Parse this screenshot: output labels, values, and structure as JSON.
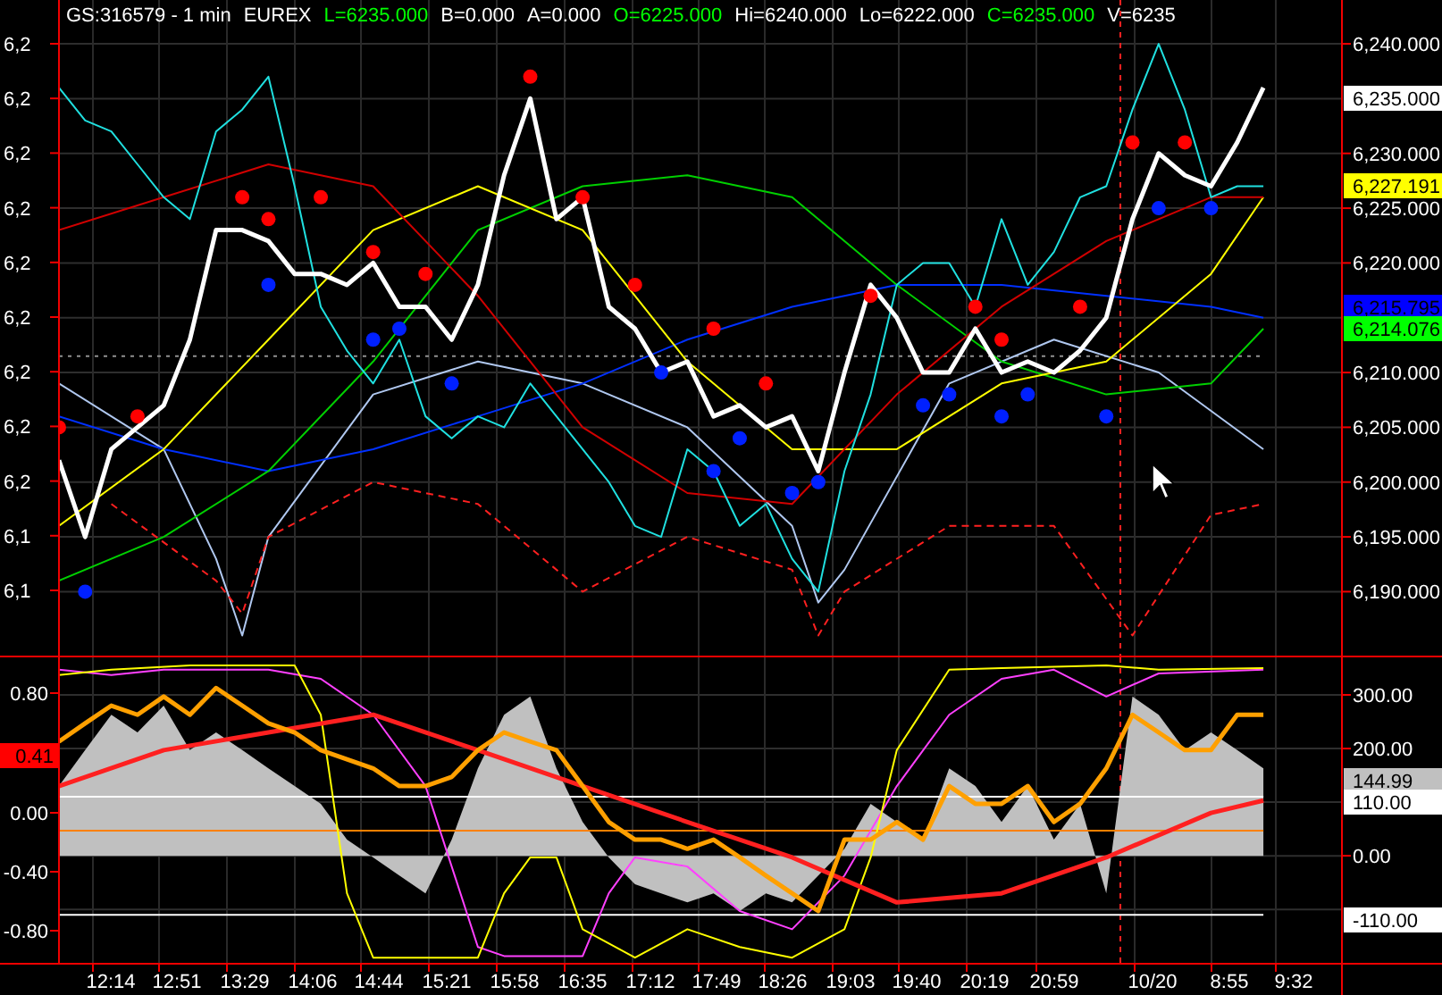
{
  "header": [
    {
      "text": "GS:316579 - 1 min",
      "color": "#ffffff"
    },
    {
      "text": "EUREX",
      "color": "#ffffff"
    },
    {
      "text": "L=6235.000",
      "color": "#00ff00"
    },
    {
      "text": "B=0.000",
      "color": "#ffffff"
    },
    {
      "text": "A=0.000",
      "color": "#ffffff"
    },
    {
      "text": "O=6225.000",
      "color": "#00ff00"
    },
    {
      "text": "Hi=6240.000",
      "color": "#ffffff"
    },
    {
      "text": "Lo=6222.000",
      "color": "#ffffff"
    },
    {
      "text": "C=6235.000",
      "color": "#00ff00"
    },
    {
      "text": "V=6235",
      "color": "#ffffff"
    }
  ],
  "price_panel": {
    "left_ticks": [
      "6,2",
      "6,2",
      "6,2",
      "6,2",
      "6,2",
      "6,2",
      "6,2",
      "6,2",
      "6,2",
      "6,1",
      "6,1"
    ],
    "tags": [
      {
        "label": "6,235.000",
        "color": "#ffffff"
      },
      {
        "label": "6,227.191",
        "color": "#ffff00"
      },
      {
        "label": "6,215.795",
        "color": "#0000ff"
      },
      {
        "label": "6,214.076",
        "color": "#00ff00"
      }
    ],
    "chart_data": {
      "type": "line",
      "grid": true,
      "ylim": [
        6184,
        6244
      ],
      "yticks": [
        {
          "value": 6240,
          "label": "6,240.000"
        },
        {
          "value": 6230,
          "label": "6,230.000"
        },
        {
          "value": 6225,
          "label": "6,225.000"
        },
        {
          "value": 6220,
          "label": "6,220.000"
        },
        {
          "value": 6210,
          "label": "6,210.000"
        },
        {
          "value": 6205,
          "label": "6,205.000"
        },
        {
          "value": 6200,
          "label": "6,200.000"
        },
        {
          "value": 6195,
          "label": "6,195.000"
        },
        {
          "value": 6190,
          "label": "6,190.000"
        }
      ],
      "series": [
        {
          "color": "#909090",
          "line_style": "dotted",
          "values": [
            6211.5,
            6211.5,
            6211.5,
            6211.5,
            6211.5,
            6211.5,
            6211.5,
            6211.5,
            6211.5,
            6211.5,
            6211.5,
            6211.5,
            6211.5,
            6211.5,
            6211.5,
            6211.5,
            6211.5,
            6211.5,
            6211.5,
            6211.5,
            6211.5,
            6211.5,
            6211.5,
            6211.5,
            6211.5,
            6211.5,
            6211.5,
            6211.5,
            6211.5,
            6211.5,
            6211.5,
            6211.5,
            6211.5,
            6211.5,
            6211.5,
            6211.5,
            6211.5,
            6211.5,
            6211.5,
            6211.5,
            6211.5,
            6211.5,
            6211.5,
            6211.5,
            6211.5,
            6211.5,
            6211.5
          ]
        },
        {
          "color": "#b0c8f0",
          "values": [
            6209,
            null,
            null,
            null,
            6203,
            null,
            6193,
            6186,
            6195,
            null,
            null,
            null,
            6208,
            null,
            null,
            null,
            6211,
            null,
            null,
            null,
            6209,
            null,
            null,
            null,
            6205,
            null,
            null,
            null,
            6196,
            6189,
            6192,
            null,
            null,
            null,
            6209,
            null,
            null,
            null,
            6213,
            null,
            null,
            null,
            6210,
            null,
            null,
            null,
            6203
          ]
        },
        {
          "color": "#ff2020",
          "line_style": "dashed",
          "values": [
            null,
            null,
            6198,
            null,
            null,
            null,
            6191,
            6188,
            6195,
            null,
            null,
            null,
            6200,
            null,
            null,
            null,
            6198,
            null,
            null,
            null,
            6190,
            null,
            null,
            null,
            6195,
            null,
            null,
            null,
            6192,
            6186,
            6190,
            null,
            null,
            null,
            6196,
            null,
            null,
            null,
            6196,
            null,
            null,
            6186,
            null,
            null,
            6197,
            null,
            6198
          ]
        },
        {
          "color": "#0030ff",
          "values": [
            6206,
            null,
            null,
            null,
            6203,
            null,
            null,
            null,
            6201,
            null,
            null,
            null,
            6203,
            null,
            null,
            null,
            6206,
            null,
            null,
            null,
            6209,
            null,
            null,
            null,
            6213,
            null,
            null,
            null,
            6216,
            null,
            null,
            null,
            6218,
            null,
            null,
            null,
            6218,
            null,
            null,
            null,
            6217,
            null,
            null,
            null,
            6216,
            null,
            6215
          ]
        },
        {
          "color": "#00d000",
          "values": [
            6191,
            null,
            null,
            null,
            6195,
            null,
            null,
            null,
            6201,
            null,
            null,
            null,
            6211,
            null,
            null,
            null,
            6223,
            null,
            null,
            null,
            6227,
            null,
            null,
            null,
            6228,
            null,
            null,
            null,
            6226,
            null,
            null,
            null,
            6218,
            null,
            null,
            null,
            6211,
            null,
            null,
            null,
            6208,
            null,
            null,
            null,
            6209,
            null,
            6214
          ]
        },
        {
          "color": "#ffff00",
          "values": [
            6196,
            null,
            null,
            null,
            6203,
            null,
            null,
            null,
            6213,
            null,
            null,
            null,
            6223,
            null,
            null,
            null,
            6227,
            null,
            null,
            null,
            6223,
            null,
            null,
            null,
            6211,
            null,
            null,
            null,
            6203,
            null,
            null,
            null,
            6203,
            null,
            null,
            null,
            6209,
            null,
            null,
            null,
            6211,
            null,
            null,
            null,
            6219,
            null,
            6226
          ]
        },
        {
          "color": "#d00000",
          "values": [
            6223,
            null,
            null,
            null,
            6226,
            null,
            null,
            null,
            6229,
            null,
            null,
            null,
            6227,
            null,
            null,
            null,
            6217,
            null,
            null,
            null,
            6205,
            null,
            null,
            null,
            6199,
            null,
            null,
            null,
            6198,
            null,
            null,
            null,
            6208,
            null,
            null,
            null,
            6216,
            null,
            null,
            null,
            6222,
            null,
            null,
            null,
            6226,
            null,
            6226
          ]
        },
        {
          "color": "#20e0e0",
          "values": [
            6236,
            6233,
            6232,
            6229,
            6226,
            6224,
            6232,
            6234,
            6237,
            6227,
            6216,
            6212,
            6209,
            6213,
            6206,
            6204,
            6206,
            6205,
            6209,
            6206,
            6203,
            6200,
            6196,
            6195,
            6203,
            6201,
            6196,
            6198,
            6193,
            6190,
            6201,
            6208,
            6218,
            6220,
            6220,
            6216,
            6224,
            6218,
            6221,
            6226,
            6227,
            6234,
            6240,
            6234,
            6226,
            6227,
            6227
          ]
        },
        {
          "color": "#ffffff",
          "values": [
            6202,
            6195,
            6203,
            6205,
            6207,
            6213,
            6223,
            6223,
            6222,
            6219,
            6219,
            6218,
            6220,
            6216,
            6216,
            6213,
            6218,
            6228,
            6235,
            6224,
            6226,
            6216,
            6214,
            6210,
            6211,
            6206,
            6207,
            6205,
            6206,
            6201,
            6210,
            6218,
            6215,
            6210,
            6210,
            6214,
            6210,
            6211,
            6210,
            6212,
            6215,
            6224,
            6230,
            6228,
            6227,
            6231,
            6236
          ]
        },
        {
          "type": "scatter",
          "color": "#ff0000",
          "values": [
            6205,
            null,
            null,
            6206,
            null,
            null,
            null,
            6226,
            6224,
            null,
            6226,
            null,
            6221,
            null,
            6219,
            null,
            null,
            null,
            6237,
            null,
            6226,
            null,
            6218,
            null,
            null,
            6214,
            null,
            6209,
            null,
            null,
            null,
            6217,
            null,
            null,
            null,
            6216,
            6213,
            null,
            null,
            6216,
            null,
            6231,
            null,
            6231,
            null,
            null,
            null
          ]
        },
        {
          "type": "scatter",
          "color": "#0020ff",
          "values": [
            null,
            6190,
            null,
            null,
            null,
            null,
            null,
            null,
            6218,
            null,
            null,
            null,
            6213,
            6214,
            null,
            6209,
            null,
            null,
            null,
            null,
            null,
            null,
            null,
            6210,
            null,
            6201,
            6204,
            null,
            6199,
            6200,
            null,
            null,
            null,
            6207,
            6208,
            null,
            6206,
            6208,
            null,
            null,
            6206,
            null,
            6225,
            null,
            6225,
            null,
            null,
            null
          ]
        }
      ]
    }
  },
  "oscillator_panel": {
    "left_ticks": [
      "0.80",
      "0.00",
      "-0.40",
      "-0.80"
    ],
    "left_tag": {
      "label": "0.41",
      "color": "#ff0000"
    },
    "tags": [
      {
        "label": "144.99",
        "color": "#c0c0c0"
      },
      {
        "label": "110.00",
        "color": "#ffffff"
      },
      {
        "label": "-110.00",
        "color": "#ffffff"
      }
    ],
    "time_axis": [
      "12:14",
      "12:51",
      "13:29",
      "14:06",
      "14:44",
      "15:21",
      "15:58",
      "16:35",
      "17:12",
      "17:49",
      "18:26",
      "19:03",
      "19:40",
      "20:19",
      "20:59",
      "10/20",
      "8:55",
      "9:32"
    ],
    "chart_data": {
      "type": "line",
      "grid": true,
      "ylim": [
        -203,
        370
      ],
      "yticks": [
        {
          "value": 300,
          "label": "300.00"
        },
        {
          "value": 200,
          "label": "200.00"
        },
        {
          "value": 0,
          "label": "0.00"
        }
      ],
      "series": [
        {
          "type": "area",
          "color": "#c0c0c0",
          "values": [
            130,
            197,
            263,
            230,
            280,
            197,
            230,
            197,
            163,
            130,
            97,
            30,
            -3,
            -37,
            -70,
            30,
            163,
            263,
            297,
            163,
            63,
            -3,
            -53,
            -70,
            -87,
            -70,
            -103,
            -70,
            -87,
            -37,
            13,
            97,
            63,
            30,
            163,
            130,
            63,
            130,
            30,
            97,
            -70,
            297,
            263,
            197,
            230,
            197,
            163
          ]
        },
        {
          "color": "#ffffff",
          "values": [
            110,
            110,
            110,
            110,
            110,
            110,
            110,
            110,
            110,
            110,
            110,
            110,
            110,
            110,
            110,
            110,
            110,
            110,
            110,
            110,
            110,
            110,
            110,
            110,
            110,
            110,
            110,
            110,
            110,
            110,
            110,
            110,
            110,
            110,
            110,
            110,
            110,
            110,
            110,
            110,
            110,
            110,
            110,
            110,
            110,
            110,
            110
          ]
        },
        {
          "color": "#ffffff",
          "values": [
            -110,
            -110,
            -110,
            -110,
            -110,
            -110,
            -110,
            -110,
            -110,
            -110,
            -110,
            -110,
            -110,
            -110,
            -110,
            -110,
            -110,
            -110,
            -110,
            -110,
            -110,
            -110,
            -110,
            -110,
            -110,
            -110,
            -110,
            -110,
            -110,
            -110,
            -110,
            -110,
            -110,
            -110,
            -110,
            -110,
            -110,
            -110,
            -110,
            -110,
            -110,
            -110,
            -110,
            -110,
            -110,
            -110,
            -110
          ]
        },
        {
          "color": "#ff8000",
          "values": [
            47,
            47,
            47,
            47,
            47,
            47,
            47,
            47,
            47,
            47,
            47,
            47,
            47,
            47,
            47,
            47,
            47,
            47,
            47,
            47,
            47,
            47,
            47,
            47,
            47,
            47,
            47,
            47,
            47,
            47,
            47,
            47,
            47,
            47,
            47,
            47,
            47,
            47,
            47,
            47,
            47,
            47,
            47,
            47,
            47,
            47,
            47
          ]
        },
        {
          "color": "#ff40ff",
          "values": [
            347,
            null,
            337,
            null,
            347,
            null,
            null,
            null,
            347,
            null,
            330,
            null,
            263,
            null,
            130,
            null,
            -170,
            -187,
            null,
            null,
            -187,
            -70,
            -3,
            null,
            -20,
            null,
            -103,
            null,
            -137,
            null,
            -37,
            null,
            130,
            null,
            263,
            null,
            330,
            null,
            347,
            null,
            297,
            null,
            340,
            null,
            null,
            null,
            347
          ]
        },
        {
          "color": "#ffff00",
          "values": [
            337,
            null,
            347,
            null,
            null,
            355,
            null,
            null,
            null,
            355,
            263,
            -70,
            -190,
            null,
            null,
            null,
            -190,
            -70,
            -3,
            -3,
            -137,
            null,
            -190,
            null,
            -137,
            null,
            -170,
            null,
            -190,
            null,
            -137,
            -3,
            197,
            null,
            347,
            null,
            350,
            null,
            null,
            null,
            355,
            null,
            347,
            null,
            null,
            null,
            350
          ]
        },
        {
          "color": "#ff2020",
          "values": [
            130,
            null,
            null,
            null,
            197,
            null,
            null,
            null,
            230,
            null,
            null,
            null,
            263,
            null,
            null,
            null,
            197,
            null,
            null,
            null,
            130,
            null,
            null,
            null,
            63,
            null,
            null,
            null,
            -3,
            null,
            null,
            null,
            -87,
            null,
            null,
            null,
            -70,
            null,
            null,
            null,
            -3,
            null,
            null,
            null,
            80,
            null,
            103
          ]
        },
        {
          "color": "#ffa000",
          "values": [
            213,
            247,
            280,
            263,
            297,
            263,
            313,
            280,
            247,
            230,
            197,
            180,
            163,
            130,
            130,
            147,
            197,
            230,
            213,
            197,
            130,
            63,
            30,
            30,
            13,
            30,
            -3,
            -37,
            -70,
            -103,
            30,
            30,
            63,
            30,
            130,
            97,
            97,
            130,
            63,
            97,
            163,
            263,
            230,
            197,
            197,
            263,
            263
          ]
        }
      ]
    }
  }
}
